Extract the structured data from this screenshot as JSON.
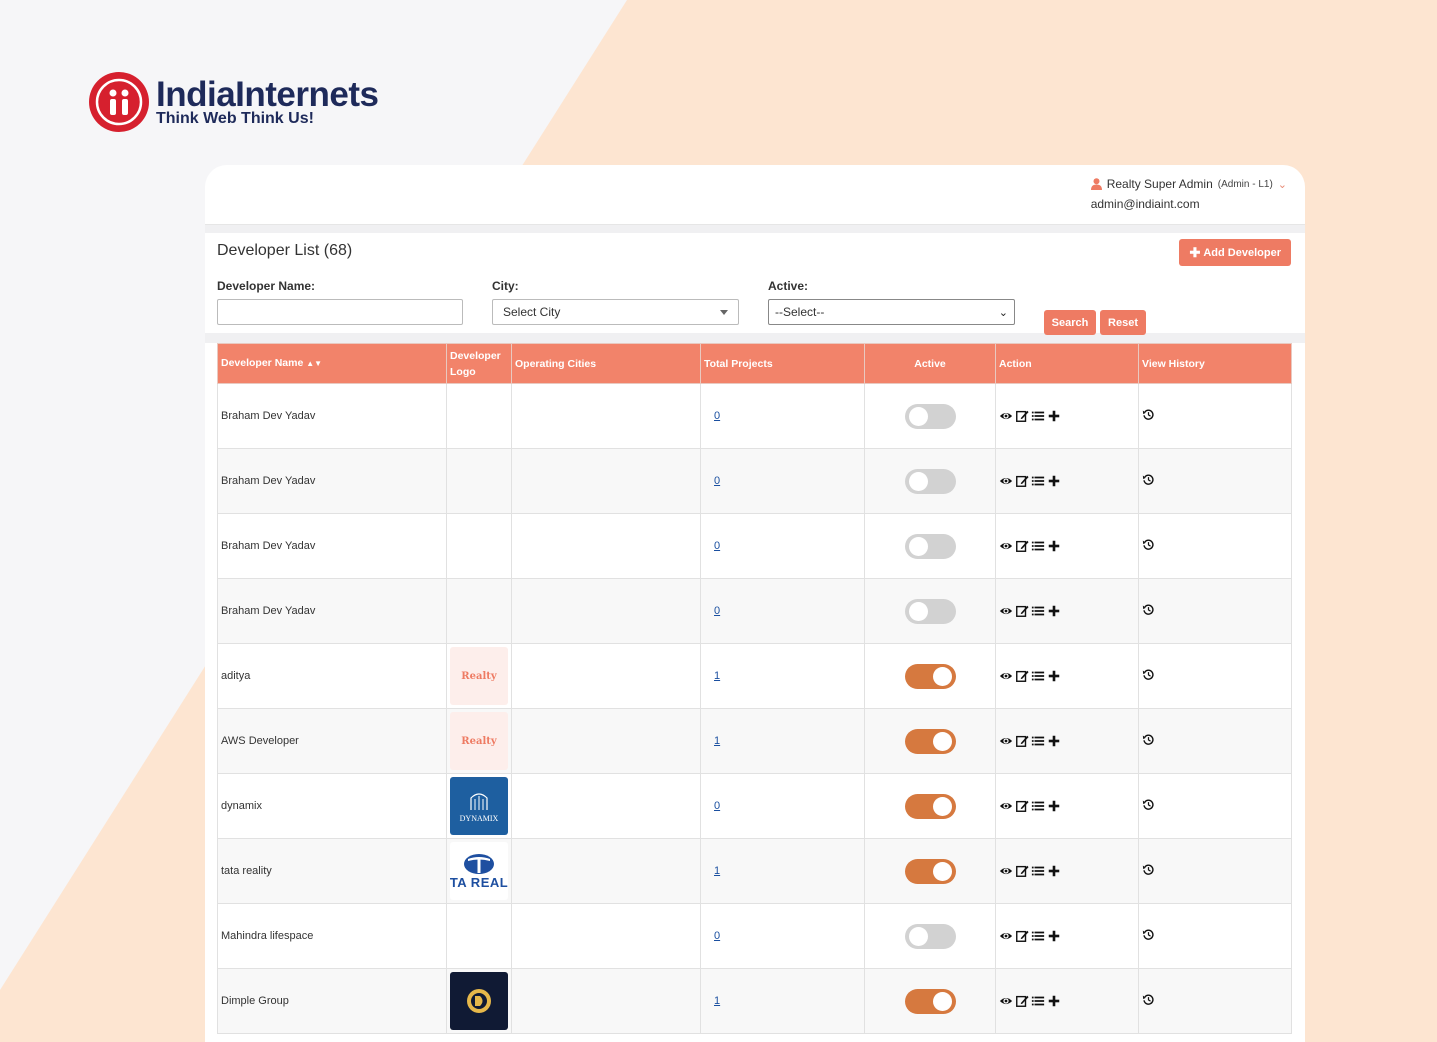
{
  "brand": {
    "name": "IndiaInternets",
    "tagline": "Think Web Think Us!"
  },
  "user": {
    "name": "Realty Super Admin",
    "role": "(Admin - L1)",
    "email": "admin@indiaint.com"
  },
  "page": {
    "title": "Developer List",
    "count": "(68)",
    "add_button": "Add Developer"
  },
  "filters": {
    "developer_name_label": "Developer Name:",
    "developer_name_value": "",
    "city_label": "City:",
    "city_value": "Select City",
    "active_label": "Active:",
    "active_value": "--Select--",
    "search_button": "Search",
    "reset_button": "Reset"
  },
  "table": {
    "columns": [
      "Developer Name",
      "Developer Logo",
      "Operating Cities",
      "Total Projects",
      "Active",
      "Action",
      "View History"
    ],
    "rows": [
      {
        "name": "Braham Dev Yadav",
        "logo": "",
        "cities": "",
        "projects": "0",
        "active": false
      },
      {
        "name": "Braham Dev Yadav",
        "logo": "",
        "cities": "",
        "projects": "0",
        "active": false
      },
      {
        "name": "Braham Dev Yadav",
        "logo": "",
        "cities": "",
        "projects": "0",
        "active": false
      },
      {
        "name": "Braham Dev Yadav",
        "logo": "",
        "cities": "",
        "projects": "0",
        "active": false
      },
      {
        "name": "aditya",
        "logo": "realty",
        "cities": "",
        "projects": "1",
        "active": true
      },
      {
        "name": "AWS Developer",
        "logo": "realty",
        "cities": "",
        "projects": "1",
        "active": true
      },
      {
        "name": "dynamix",
        "logo": "dynamix",
        "cities": "",
        "projects": "0",
        "active": true
      },
      {
        "name": "tata reality",
        "logo": "tata",
        "cities": "",
        "projects": "1",
        "active": true
      },
      {
        "name": "Mahindra lifespace",
        "logo": "",
        "cities": "",
        "projects": "0",
        "active": false
      },
      {
        "name": "Dimple Group",
        "logo": "dimple",
        "cities": "",
        "projects": "1",
        "active": true
      }
    ]
  },
  "logos": {
    "realty_text": "Realty",
    "dynamix_text": "DYNAMIX",
    "tata_text": "TA REAL"
  },
  "colors": {
    "accent": "#ee7b63",
    "header": "#f2836a",
    "toggle_on": "#d6793f",
    "toggle_off": "#d2d2d2",
    "brand_red": "#d6202e",
    "brand_navy": "#1e2a5a"
  },
  "icons": {
    "action_icons": [
      "eye-icon",
      "edit-icon",
      "list-icon",
      "plus-icon"
    ],
    "history_icon": "history-icon",
    "user_icon": "user-icon"
  }
}
